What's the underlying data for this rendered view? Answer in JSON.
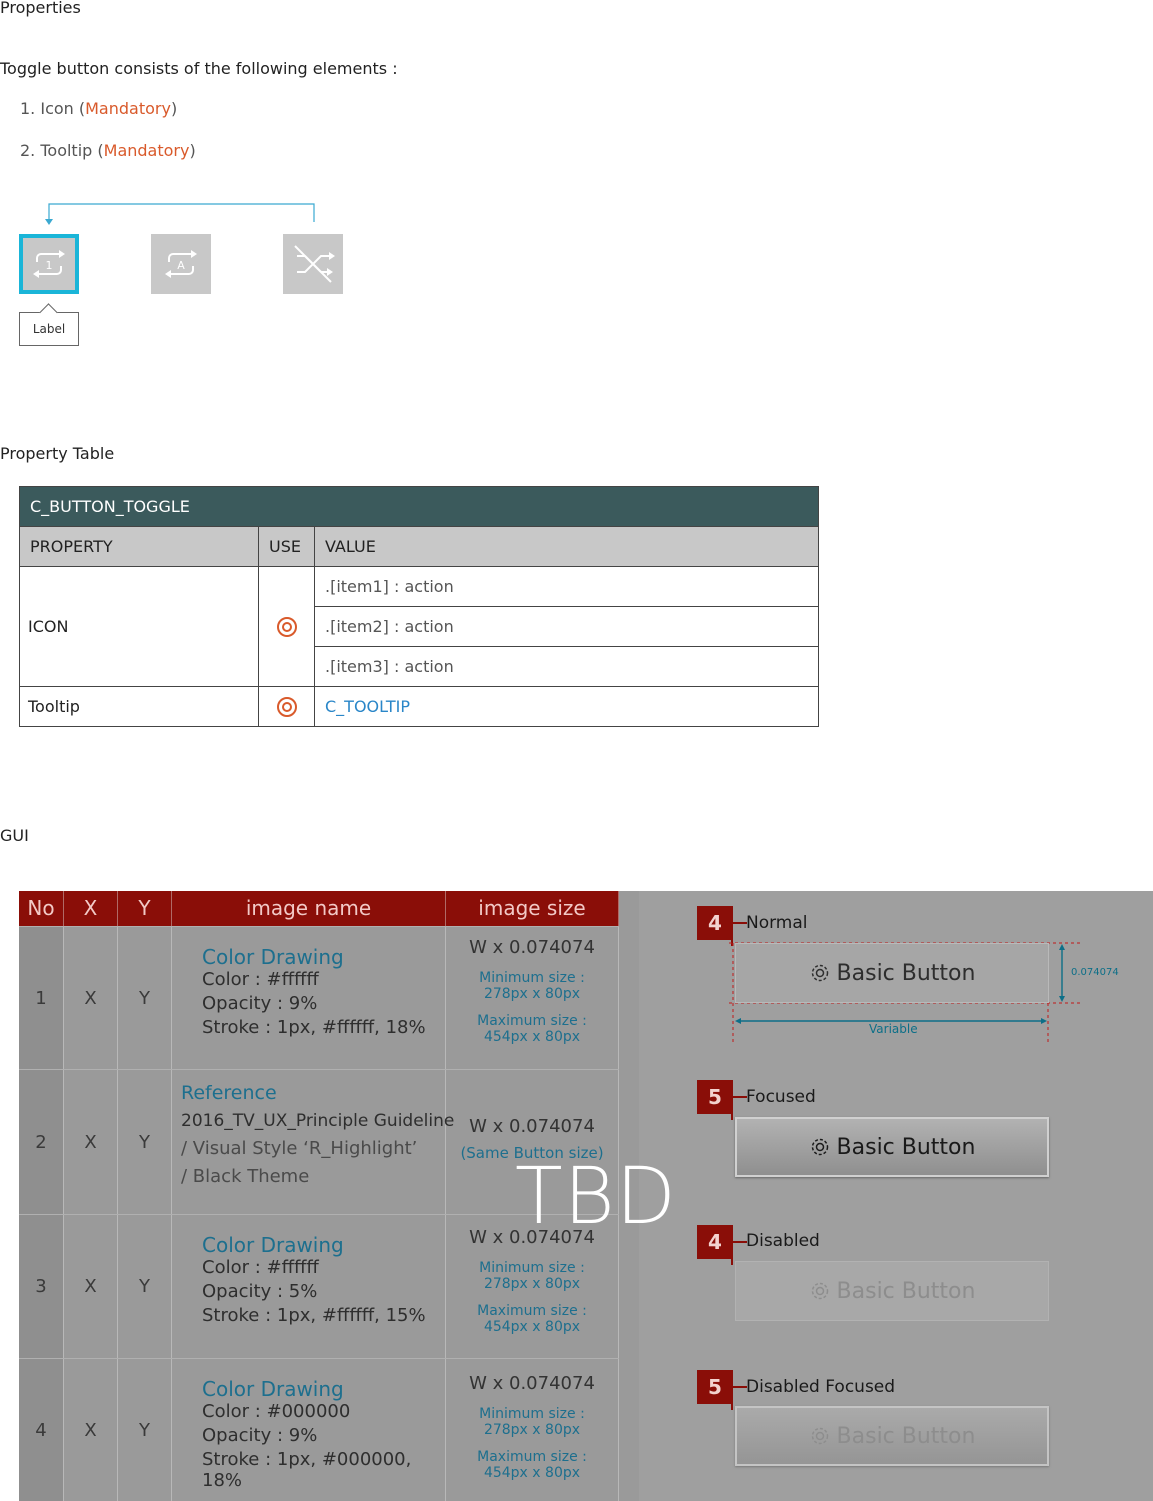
{
  "sections": {
    "properties": "Properties",
    "property_table": "Property Table",
    "gui": "GUI"
  },
  "intro": "Toggle button consists of the following elements :",
  "elements": [
    {
      "prefix": "1. Icon (",
      "tag": "Mandatory",
      "suffix": ")"
    },
    {
      "prefix": "2. Tooltip (",
      "tag": "Mandatory",
      "suffix": ")"
    }
  ],
  "demo": {
    "icons": [
      "repeat-one-icon",
      "repeat-all-icon",
      "shuffle-off-icon"
    ],
    "focused_index": 0,
    "tooltip_label": "Label",
    "colors": {
      "focus_border": "#1ab5d8",
      "button_bg": "#c8c8c8"
    }
  },
  "property_table": {
    "title": "C_BUTTON_TOGGLE",
    "columns": [
      "PROPERTY",
      "USE",
      "VALUE"
    ],
    "rows": [
      {
        "property": "ICON",
        "use": "mandatory-circle-icon",
        "values": [
          ".[item1] : action",
          ".[item2] : action",
          ".[item3] : action"
        ]
      },
      {
        "property": "Tooltip",
        "use": "mandatory-circle-icon",
        "values": [
          "C_TOOLTIP"
        ]
      }
    ],
    "colors": {
      "header_bg": "#3b5a5c",
      "column_bg": "#c8c8c8",
      "link": "#2a86c8",
      "mandatory": "#d95a2b"
    }
  },
  "gui": {
    "columns": [
      "No",
      "X",
      "Y",
      "image name",
      "image size"
    ],
    "rows": [
      {
        "no": "1",
        "x": "X",
        "y": "Y",
        "name_title": "Color Drawing",
        "name_lines": [
          "Color : #ffffff",
          "Opacity : 9%",
          "Stroke : 1px, #ffffff, 18%"
        ],
        "size": "W x 0.074074",
        "size_notes": [
          "Minimum size :",
          "278px x 80px",
          "Maximum size :",
          "454px x 80px"
        ]
      },
      {
        "no": "2",
        "x": "X",
        "y": "Y",
        "name_title": "Reference",
        "name_lines": [
          "2016_TV_UX_Principle Guideline",
          "/ Visual Style ‘R_Highlight’",
          "/ Black Theme"
        ],
        "size": "W x 0.074074",
        "size_notes": [
          "(Same Button size)"
        ]
      },
      {
        "no": "3",
        "x": "X",
        "y": "Y",
        "name_title": "Color Drawing",
        "name_lines": [
          "Color : #ffffff",
          "Opacity : 5%",
          "Stroke : 1px, #ffffff, 15%"
        ],
        "size": "W x 0.074074",
        "size_notes": [
          "Minimum size :",
          "278px x 80px",
          "Maximum size :",
          "454px x 80px"
        ]
      },
      {
        "no": "4",
        "x": "X",
        "y": "Y",
        "name_title": "Color Drawing",
        "name_lines": [
          "Color : #000000",
          "Opacity : 9%",
          "Stroke : 1px, #000000, 18%"
        ],
        "size": "W x 0.074074",
        "size_notes": [
          "Minimum size :",
          "278px x 80px",
          "Maximum size :",
          "454px x 80px"
        ]
      }
    ],
    "states": [
      {
        "badge": "4",
        "label": "Normal"
      },
      {
        "badge": "5",
        "label": "Focused"
      },
      {
        "badge": "4",
        "label": "Disabled"
      },
      {
        "badge": "5",
        "label": "Disabled Focused"
      }
    ],
    "button_label": "Basic Button",
    "dimension_height": "0.074074",
    "dimension_width": "Variable",
    "overlay": "TBD",
    "colors": {
      "header_red": "#8a0e08",
      "title_blue": "#1d6f8e",
      "dim_line": "#0d6f88"
    }
  }
}
